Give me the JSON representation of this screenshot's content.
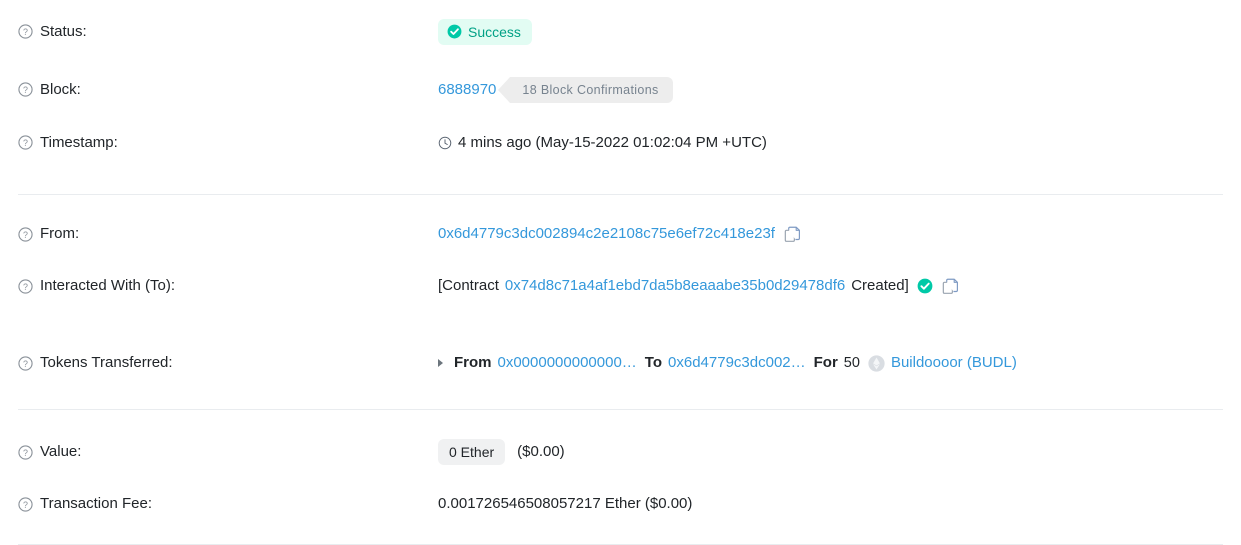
{
  "rows": {
    "status": {
      "label": "Status:",
      "help_icon": "question-circle-icon",
      "badge_text": "Success",
      "badge_icon": "check-circle-icon",
      "badge_bg": "#e2fcf3",
      "badge_color": "#00a186"
    },
    "block": {
      "label": "Block:",
      "help_icon": "question-circle-icon",
      "number": "6888970",
      "confirmations": "18 Block Confirmations"
    },
    "timestamp": {
      "label": "Timestamp:",
      "help_icon": "question-circle-icon",
      "clock_icon": "clock-icon",
      "text": "4 mins ago (May-15-2022 01:02:04 PM +UTC)"
    },
    "from": {
      "label": "From:",
      "help_icon": "question-circle-icon",
      "address": "0x6d4779c3dc002894c2e2108c75e6ef72c418e23f",
      "copy_icon": "copy-icon"
    },
    "interacted_with": {
      "label": "Interacted With (To):",
      "help_icon": "question-circle-icon",
      "prefix": "[Contract",
      "address": "0x74d8c71a4af1ebd7da5b8eaaabe35b0d29478df6",
      "suffix": "Created]",
      "verified_icon": "verified-check-icon",
      "copy_icon": "copy-icon"
    },
    "tokens_transferred": {
      "label": "Tokens Transferred:",
      "help_icon": "question-circle-icon",
      "expand_icon": "caret-right-icon",
      "from_keyword": "From",
      "from_address": "0x0000000000000…",
      "to_keyword": "To",
      "to_address": "0x6d4779c3dc002…",
      "for_keyword": "For",
      "amount": "50",
      "token_icon": "ethereum-diamond-icon",
      "token_name": "Buildoooor (BUDL)"
    },
    "value": {
      "label": "Value:",
      "help_icon": "question-circle-icon",
      "pill_text": "0 Ether",
      "usd": "($0.00)"
    },
    "transaction_fee": {
      "label": "Transaction Fee:",
      "help_icon": "question-circle-icon",
      "text": "0.001726546508057217 Ether ($0.00)"
    }
  },
  "colors": {
    "link": "#3498db",
    "success": "#00c9a7",
    "muted": "#77838f",
    "divider": "#e9ecef"
  }
}
